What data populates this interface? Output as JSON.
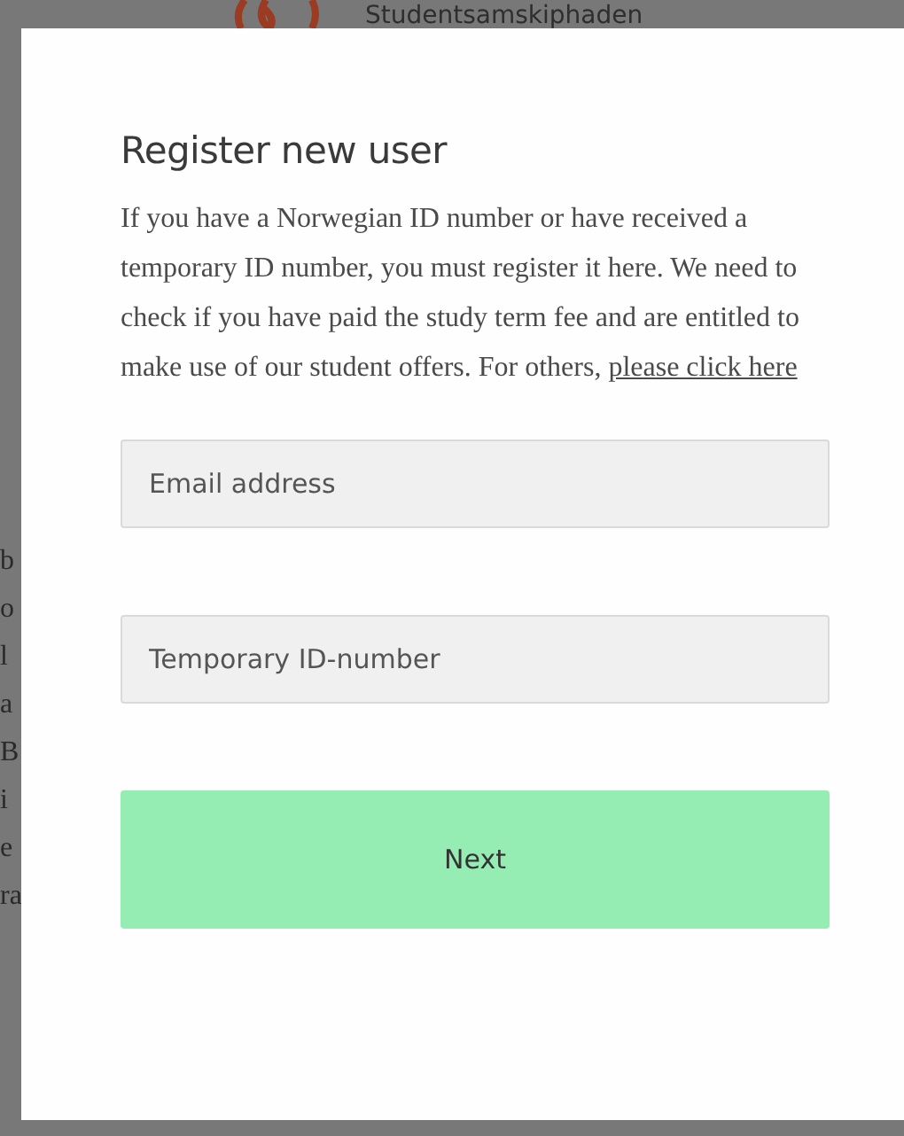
{
  "background": {
    "site_name": "Studentsamskiphaden",
    "text_fragments": [
      "b",
      "o",
      "l",
      "a",
      "B",
      "i",
      "e",
      "ra"
    ]
  },
  "dialog": {
    "title": "Register new user",
    "intro": "If you have a Norwegian ID number or have received a temporary ID number, you must register it here. We need to check if you have paid the study term fee and are entitled to make use of our student offers. For others,",
    "link": "please click here",
    "fields": [
      {
        "placeholder": "Email address"
      },
      {
        "placeholder": "Temporary ID-number"
      }
    ],
    "button": "Next"
  }
}
